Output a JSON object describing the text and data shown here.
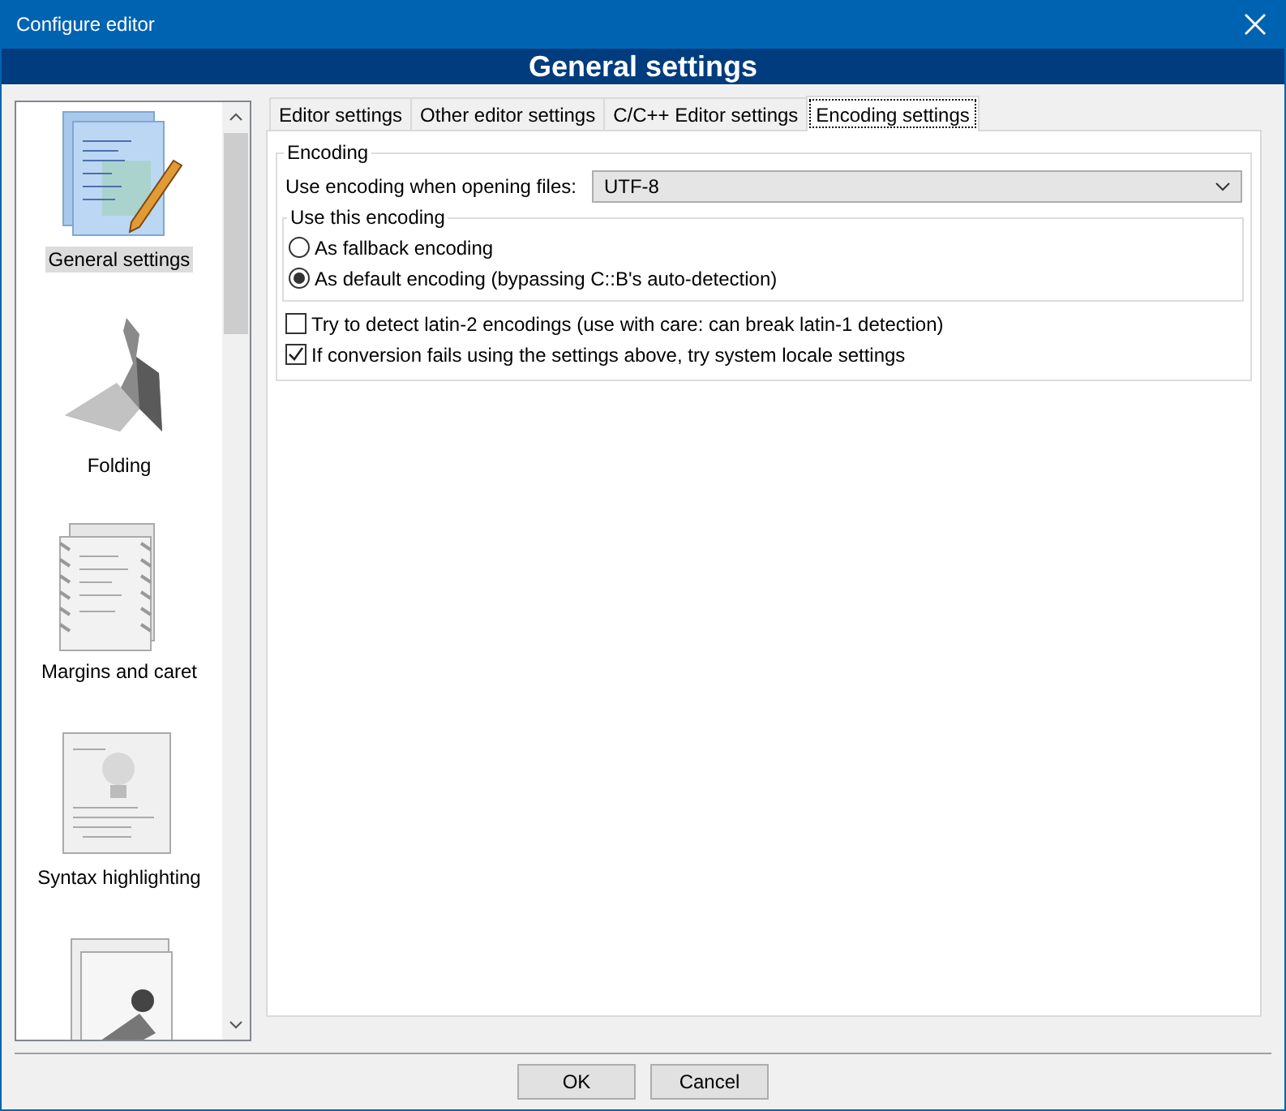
{
  "window": {
    "title": "Configure editor",
    "header": "General settings"
  },
  "sidebar": {
    "items": [
      {
        "kind": "pages",
        "label": "General settings",
        "selected": true
      },
      {
        "kind": "origami",
        "label": "Folding",
        "selected": false
      },
      {
        "kind": "margins",
        "label": "Margins and caret",
        "selected": false
      },
      {
        "kind": "syntax",
        "label": "Syntax highlighting",
        "selected": false
      },
      {
        "kind": "stamp"
      }
    ]
  },
  "tabs": [
    {
      "label": "Editor settings",
      "selected": false
    },
    {
      "label": "Other editor settings",
      "selected": false
    },
    {
      "label": "C/C++ Editor settings",
      "selected": false
    },
    {
      "label": "Encoding settings",
      "selected": true
    }
  ],
  "encoding_group": {
    "title": "Encoding",
    "select_label": "Use encoding when opening files:",
    "select_value": "UTF-8",
    "radio_group": {
      "title": "Use this encoding",
      "options": [
        {
          "label": "As fallback encoding",
          "selected": false
        },
        {
          "label": "As default encoding (bypassing C::B's auto-detection)",
          "selected": true
        }
      ]
    },
    "checkboxes": [
      {
        "label": "Try to detect latin-2 encodings (use with care: can break latin-1 detection)",
        "checked": false
      },
      {
        "label": "If conversion fails using the settings above, try system locale settings",
        "checked": true
      }
    ]
  },
  "buttons": [
    "OK",
    "Cancel"
  ]
}
